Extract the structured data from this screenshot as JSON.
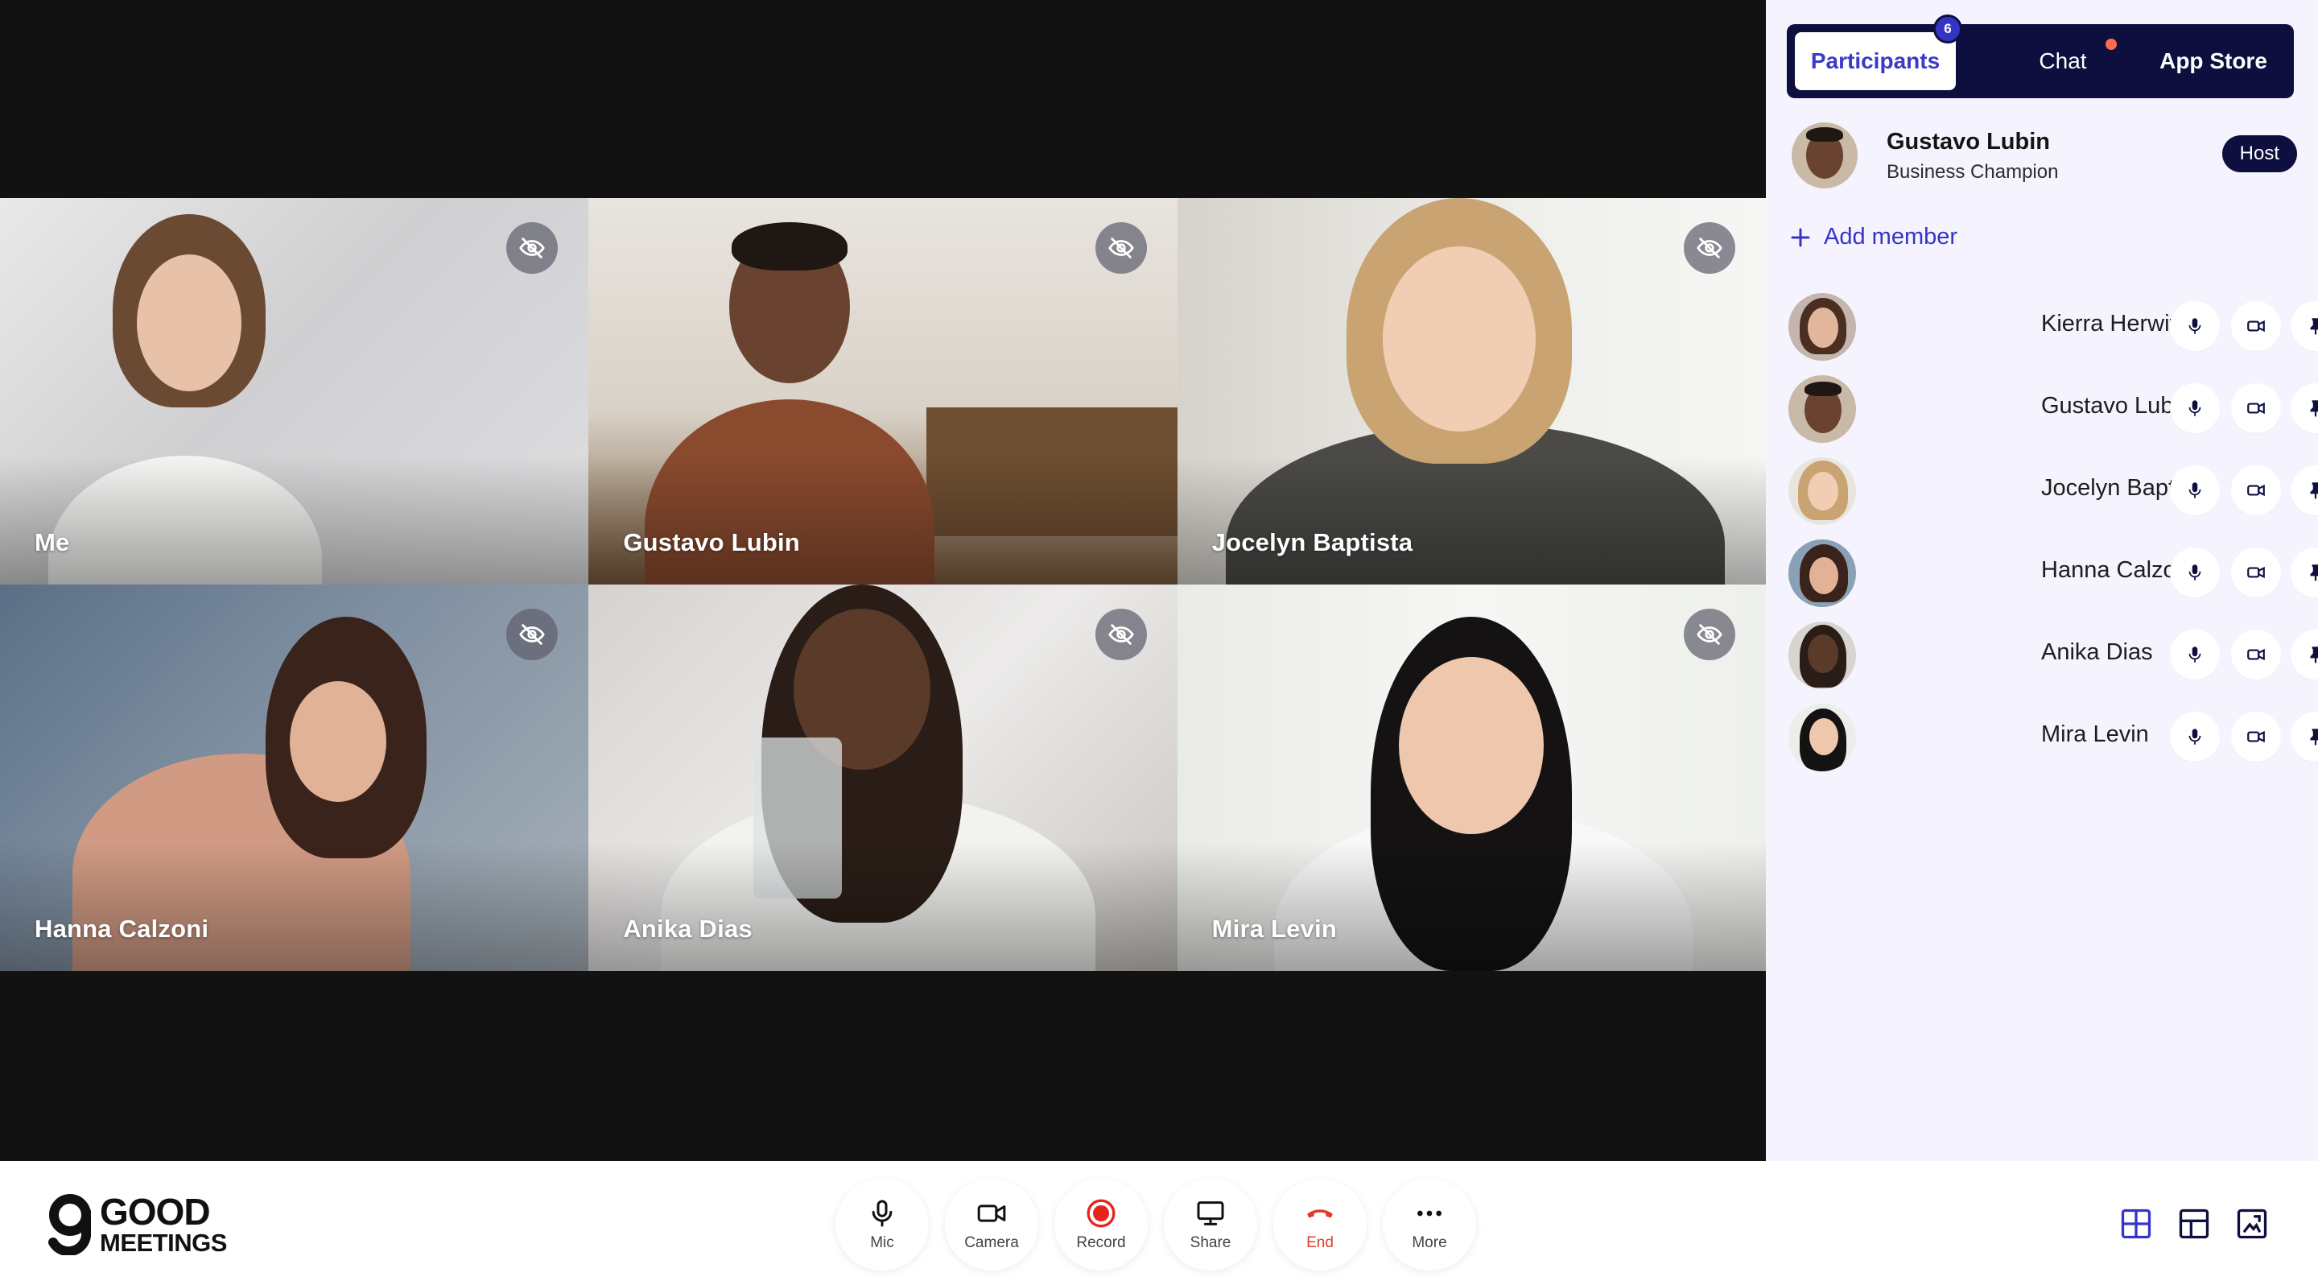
{
  "app": {
    "brand_line1": "GOOD",
    "brand_line2": "MEETINGS"
  },
  "colors": {
    "accent": "#3535c5",
    "navy": "#0e0f3e",
    "sidebar_bg": "#f5f4fe",
    "stage_bg": "#131212",
    "end_red": "#e23a2a",
    "record_red": "#e5251b",
    "chat_dot": "#ff6a4d"
  },
  "tiles": [
    {
      "name": "Me",
      "hide_icon": "eye-off-icon"
    },
    {
      "name": "Gustavo Lubin",
      "hide_icon": "eye-off-icon"
    },
    {
      "name": "Jocelyn Baptista",
      "hide_icon": "eye-off-icon"
    },
    {
      "name": "Hanna Calzoni",
      "hide_icon": "eye-off-icon"
    },
    {
      "name": "Anika Dias",
      "hide_icon": "eye-off-icon"
    },
    {
      "name": "Mira Levin",
      "hide_icon": "eye-off-icon"
    }
  ],
  "sidebar": {
    "tabs": [
      {
        "label": "Participants",
        "badge": "6",
        "active": true
      },
      {
        "label": "Chat",
        "unread_dot": true
      },
      {
        "label": "App Store"
      }
    ],
    "host": {
      "name": "Gustavo Lubin",
      "subtitle": "Business Champion",
      "badge": "Host"
    },
    "add_member_label": "Add member",
    "participants": [
      {
        "name": "Kierra Herwitz"
      },
      {
        "name": "Gustavo Lubin"
      },
      {
        "name": "Jocelyn Baptista"
      },
      {
        "name": "Hanna Calzoni"
      },
      {
        "name": "Anika Dias"
      },
      {
        "name": "Mira Levin"
      }
    ],
    "row_controls": [
      "mic-icon",
      "camera-icon",
      "pin-icon"
    ]
  },
  "controls": [
    {
      "label": "Mic",
      "icon": "mic-icon"
    },
    {
      "label": "Camera",
      "icon": "camera-icon"
    },
    {
      "label": "Record",
      "icon": "record-icon"
    },
    {
      "label": "Share",
      "icon": "monitor-icon"
    },
    {
      "label": "End",
      "icon": "phone-hangup-icon"
    },
    {
      "label": "More",
      "icon": "more-icon"
    }
  ],
  "view_modes": [
    "grid-view-icon",
    "spotlight-view-icon",
    "fullscreen-view-icon"
  ]
}
